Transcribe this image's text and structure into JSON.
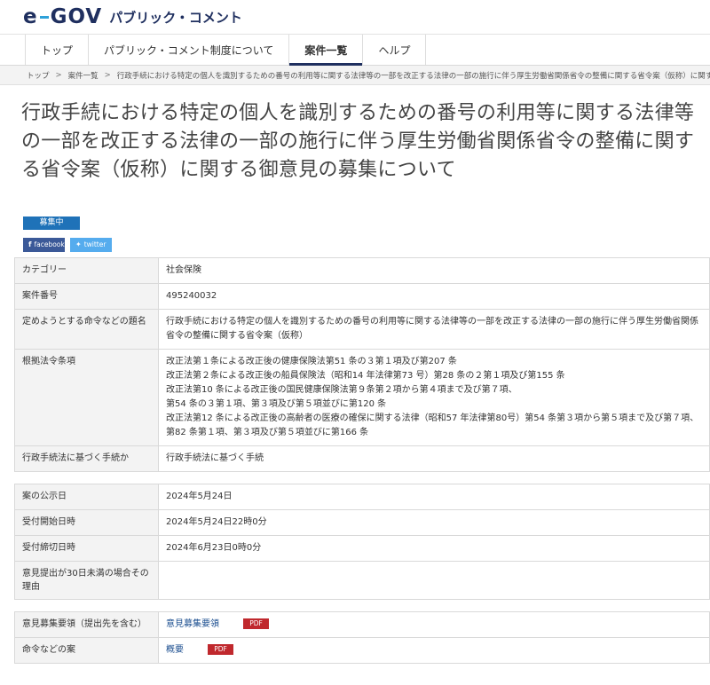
{
  "header": {
    "logo_text": "e-GOV",
    "logo_sub": "パブリック・コメント"
  },
  "nav": {
    "items": [
      "トップ",
      "パブリック・コメント制度について",
      "案件一覧",
      "ヘルプ"
    ],
    "active": 2
  },
  "breadcrumb": [
    "トップ",
    "案件一覧",
    "行政手続における特定の個人を識別するための番号の利用等に関する法律等の一部を改正する法律の一部の施行に伴う厚生労働省関係省令の整備に関する省令案（仮称）に関する御意見の..."
  ],
  "title": "行政手続における特定の個人を識別するための番号の利用等に関する法律等の一部を改正する法律の一部の施行に伴う厚生労働省関係省令の整備に関する省令案（仮称）に関する御意見の募集について",
  "status_badge": "募集中",
  "share": {
    "facebook": "facebook",
    "twitter": "twitter"
  },
  "info_table": {
    "category_label": "カテゴリー",
    "category_value": "社会保険",
    "case_number_label": "案件番号",
    "case_number_value": "495240032",
    "subject_label": "定めようとする命令などの題名",
    "subject_value": "行政手続における特定の個人を識別するための番号の利用等に関する法律等の一部を改正する法律の一部の施行に伴う厚生労働省関係省令の整備に関する省令案（仮称）",
    "basis_label": "根拠法令条項",
    "basis_lines": [
      "改正法第１条による改正後の健康保険法第51 条の３第１項及び第207 条",
      "改正法第２条による改正後の船員保険法（昭和14 年法律第73 号）第28 条の２第１項及び第155 条",
      "改正法第10 条による改正後の国民健康保険法第９条第２項から第４項まで及び第７項、",
      "第54 条の３第１項、第３項及び第５項並びに第120 条",
      "改正法第12 条による改正後の高齢者の医療の確保に関する法律（昭和57 年法律第80号）第54 条第３項から第５項まで及び第７項、第82 条第１項、第３項及び第５項並びに第166 条"
    ],
    "procedure_label": "行政手続法に基づく手続か",
    "procedure_value": "行政手続法に基づく手続"
  },
  "date_table": {
    "announce_label": "案の公示日",
    "announce_value": "2024年5月24日",
    "start_label": "受付開始日時",
    "start_value": "2024年5月24日22時0分",
    "end_label": "受付締切日時",
    "end_value": "2024年6月23日0時0分",
    "reason_label": "意見提出が30日未満の場合その理由",
    "reason_value": ""
  },
  "doc_table": {
    "guide_label": "意見募集要領（提出先を含む）",
    "guide_link": "意見募集要領",
    "guide_pdf": "PDF",
    "draft_label": "命令などの案",
    "draft_link": "概要",
    "draft_pdf": "PDF"
  },
  "colors": {
    "brand": "#1f2f5f",
    "accent": "#2ea1d9",
    "badge": "#1f72b8",
    "pdf": "#c0282d"
  }
}
